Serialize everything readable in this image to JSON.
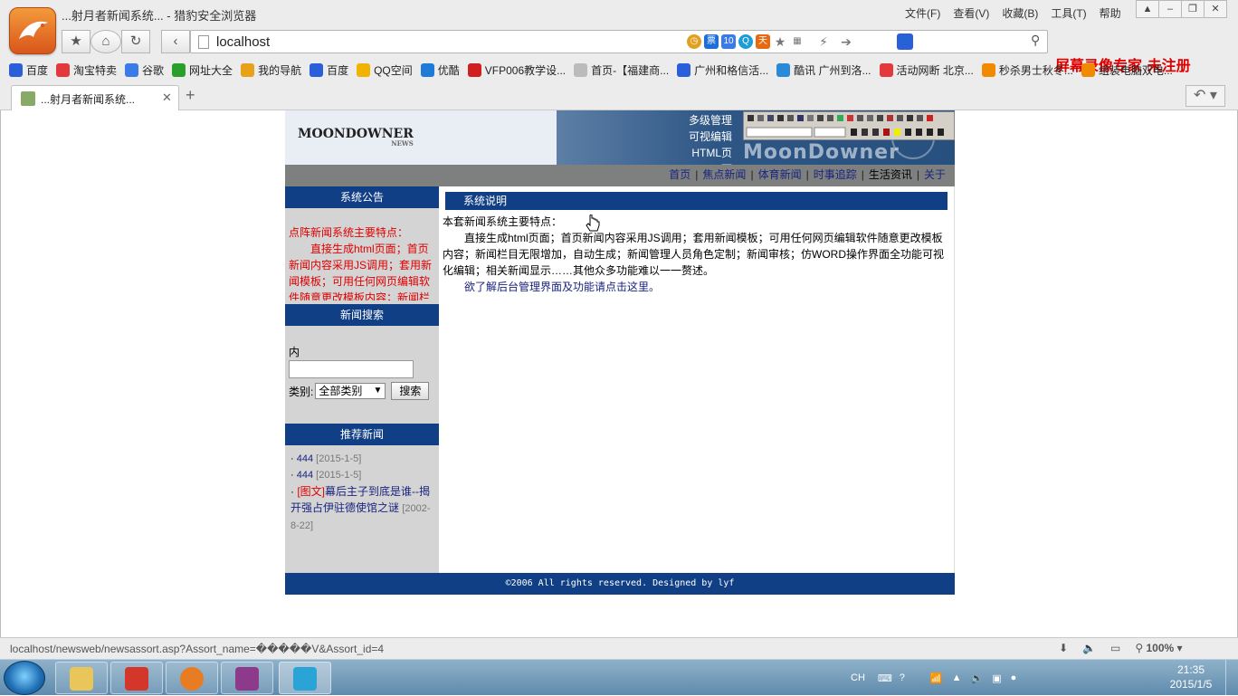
{
  "browser": {
    "window_title": "...射月者新闻系统... - 猎豹安全浏览器",
    "menus": [
      "文件(F)",
      "查看(V)",
      "收藏(B)",
      "工具(T)",
      "帮助"
    ],
    "url": "localhost",
    "watermark": "屏幕录像专家 未注册",
    "bookmarks": [
      {
        "label": "百度",
        "icon": "paw-icon",
        "color": "#2b5fd9"
      },
      {
        "label": "淘宝特卖",
        "icon": "taobao-icon",
        "color": "#e4393c"
      },
      {
        "label": "谷歌",
        "icon": "google-icon",
        "color": "#3b7be8"
      },
      {
        "label": "网址大全",
        "icon": "ie-icon",
        "color": "#2aa02a"
      },
      {
        "label": "我的导航",
        "icon": "folder-icon",
        "color": "#e7a21a"
      },
      {
        "label": "百度",
        "icon": "paw-icon",
        "color": "#2b5fd9"
      },
      {
        "label": "QQ空间",
        "icon": "star-icon",
        "color": "#f0b400"
      },
      {
        "label": "优酷",
        "icon": "play-icon",
        "color": "#1e7bd8"
      },
      {
        "label": "VFP006教学设...",
        "icon": "bookmark-icon",
        "color": "#d01f1f"
      },
      {
        "label": "首页-【福建商...",
        "icon": "page-icon",
        "color": "#bbbbbb"
      },
      {
        "label": "广州和格信活...",
        "icon": "paw-icon",
        "color": "#2b5fd9"
      },
      {
        "label": "酷讯 广州到洛...",
        "icon": "kuxun-icon",
        "color": "#2a8ad8"
      },
      {
        "label": "活动网断 北京...",
        "icon": "e-icon",
        "color": "#e4393c"
      },
      {
        "label": "秒杀男士秋冬...",
        "icon": "taobao-icon",
        "color": "#f08a00"
      },
      {
        "label": "组装电脑双电...",
        "icon": "taobao-icon",
        "color": "#f08a00"
      }
    ],
    "tab_title": "...射月者新闻系统...",
    "status_url": "localhost/newsweb/newsassort.asp?Assort_name=�����V&Assort_id=4",
    "zoom": "100%"
  },
  "site": {
    "logo": "MOONDOWNER",
    "logo_sub": "NEWS",
    "banner_features": [
      "多级管理",
      "可视编辑",
      "HTML页面"
    ],
    "banner_bigtext": "MoonDowner",
    "nav": [
      "首页",
      "焦点新闻",
      "体育新闻",
      "时事追踪",
      "生活资讯",
      "关于"
    ],
    "sidebar": {
      "notice_title": "系统公告",
      "notice_text": "点阵新闻系统主要特点：",
      "notice_body": "直接生成html页面；首页新闻内容采用JS调用；套用新闻模板；可用任何网页编辑软件随意更改模板内容；新闻栏",
      "search_title": "新闻搜索",
      "content_label": "内容:",
      "category_label": "类别:",
      "category_value": "全部类别",
      "search_button": "搜索",
      "recommend_title": "推荐新闻",
      "recommend": [
        {
          "title": "444",
          "date": "[2015-1-5]"
        },
        {
          "title": "444",
          "date": "[2015-1-5]"
        },
        {
          "prefix": "[图文]",
          "title": "幕后主子到底是谁--揭开强占伊驻德使馆之谜",
          "date": "[2002-8-22]"
        }
      ]
    },
    "main": {
      "heading": "系统说明",
      "intro": "本套新闻系统主要特点：",
      "body": "直接生成html页面；首页新闻内容采用JS调用；套用新闻模板；可用任何网页编辑软件随意更改模板内容；新闻栏目无限增加，自动生成；新闻管理人员角色定制；新闻审核；仿WORD操作界面全功能可视化编辑；相关新闻显示……其他众多功能难以一一赘述。",
      "link": "欲了解后台管理界面及功能请点击这里。"
    },
    "footer": "©2006  All rights reserved. Designed by lyf"
  },
  "taskbar": {
    "ime": "CH",
    "time": "21:35",
    "date": "2015/1/5"
  }
}
